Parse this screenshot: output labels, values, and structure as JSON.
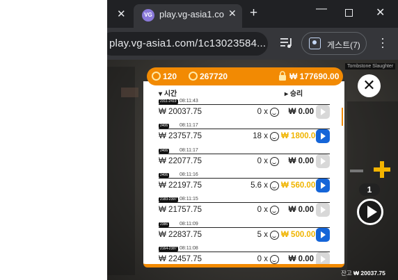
{
  "browser": {
    "tab_title": "play.vg-asia1.co",
    "favicon_text": "VG",
    "url": "play.vg-asia1.com/1c13023584...",
    "profile_label": "게스트(7)"
  },
  "game": {
    "watermark": "Tombstone Slaughter",
    "header": {
      "coin_value": "120",
      "chips_value": "267720",
      "locked_balance": "₩ 177690.00"
    },
    "columns": {
      "time": "시간",
      "win": "승리"
    },
    "rows": [
      {
        "tag": "2311-2419",
        "time": "08:11:43",
        "balance": "₩ 20037.75",
        "mult": "0 x",
        "win": "₩ 0.00",
        "gold": false,
        "active": false
      },
      {
        "tag": "2406",
        "time": "08:11:17",
        "balance": "₩ 23757.75",
        "mult": "18 x",
        "win": "₩ 1800.00",
        "gold": true,
        "active": true
      },
      {
        "tag": "2406",
        "time": "08:11:17",
        "balance": "₩ 22077.75",
        "mult": "0 x",
        "win": "₩ 0.00",
        "gold": false,
        "active": false
      },
      {
        "tag": "2406",
        "time": "08:11:16",
        "balance": "₩ 22197.75",
        "mult": "5.6 x",
        "win": "₩ 560.00",
        "gold": true,
        "active": true
      },
      {
        "tag": "2183-2397",
        "time": "08:11:15",
        "balance": "₩ 21757.75",
        "mult": "0 x",
        "win": "₩ 0.00",
        "gold": false,
        "active": false
      },
      {
        "tag": "2386",
        "time": "08:11:09",
        "balance": "₩ 22837.75",
        "mult": "5 x",
        "win": "₩ 500.00",
        "gold": true,
        "active": true
      },
      {
        "tag": "2164-2387",
        "time": "08:11:08",
        "balance": "₩ 22457.75",
        "mult": "0 x",
        "win": "₩ 0.00",
        "gold": false,
        "active": false
      }
    ],
    "bet_count": "1",
    "footer": {
      "label": "잔고",
      "balance": "₩ 20037.75"
    },
    "colors": {
      "accent": "#f28a03",
      "gold": "#f0b400",
      "blue": "#1565d8"
    },
    "icons": [
      "close-icon",
      "plus-icon",
      "minus-icon",
      "play-icon",
      "smiley-icon",
      "lock-icon"
    ]
  }
}
